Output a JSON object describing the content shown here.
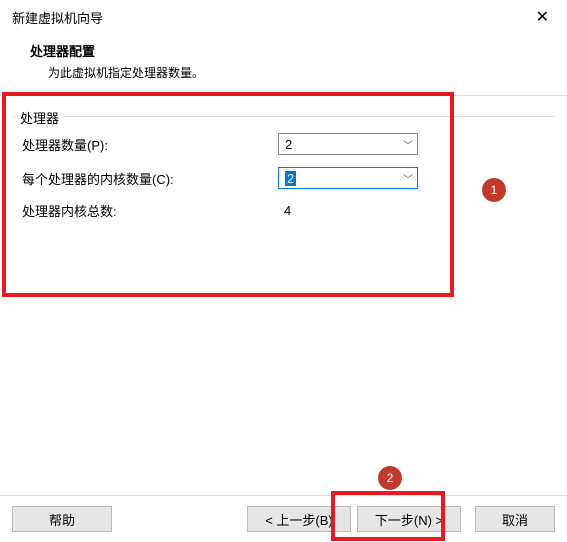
{
  "window": {
    "title": "新建虚拟机向导"
  },
  "header": {
    "title": "处理器配置",
    "subtitle": "为此虚拟机指定处理器数量。"
  },
  "fieldset": {
    "legend": "处理器",
    "rows": {
      "processors": {
        "label": "处理器数量(P):",
        "value": "2"
      },
      "coresPerProcessor": {
        "label": "每个处理器的内核数量(C):",
        "value": "2"
      },
      "totalCores": {
        "label": "处理器内核总数:",
        "value": "4"
      }
    }
  },
  "annotations": {
    "badge1": "1",
    "badge2": "2"
  },
  "buttons": {
    "help": "帮助",
    "back": "< 上一步(B)",
    "next": "下一步(N) >",
    "cancel": "取消"
  }
}
